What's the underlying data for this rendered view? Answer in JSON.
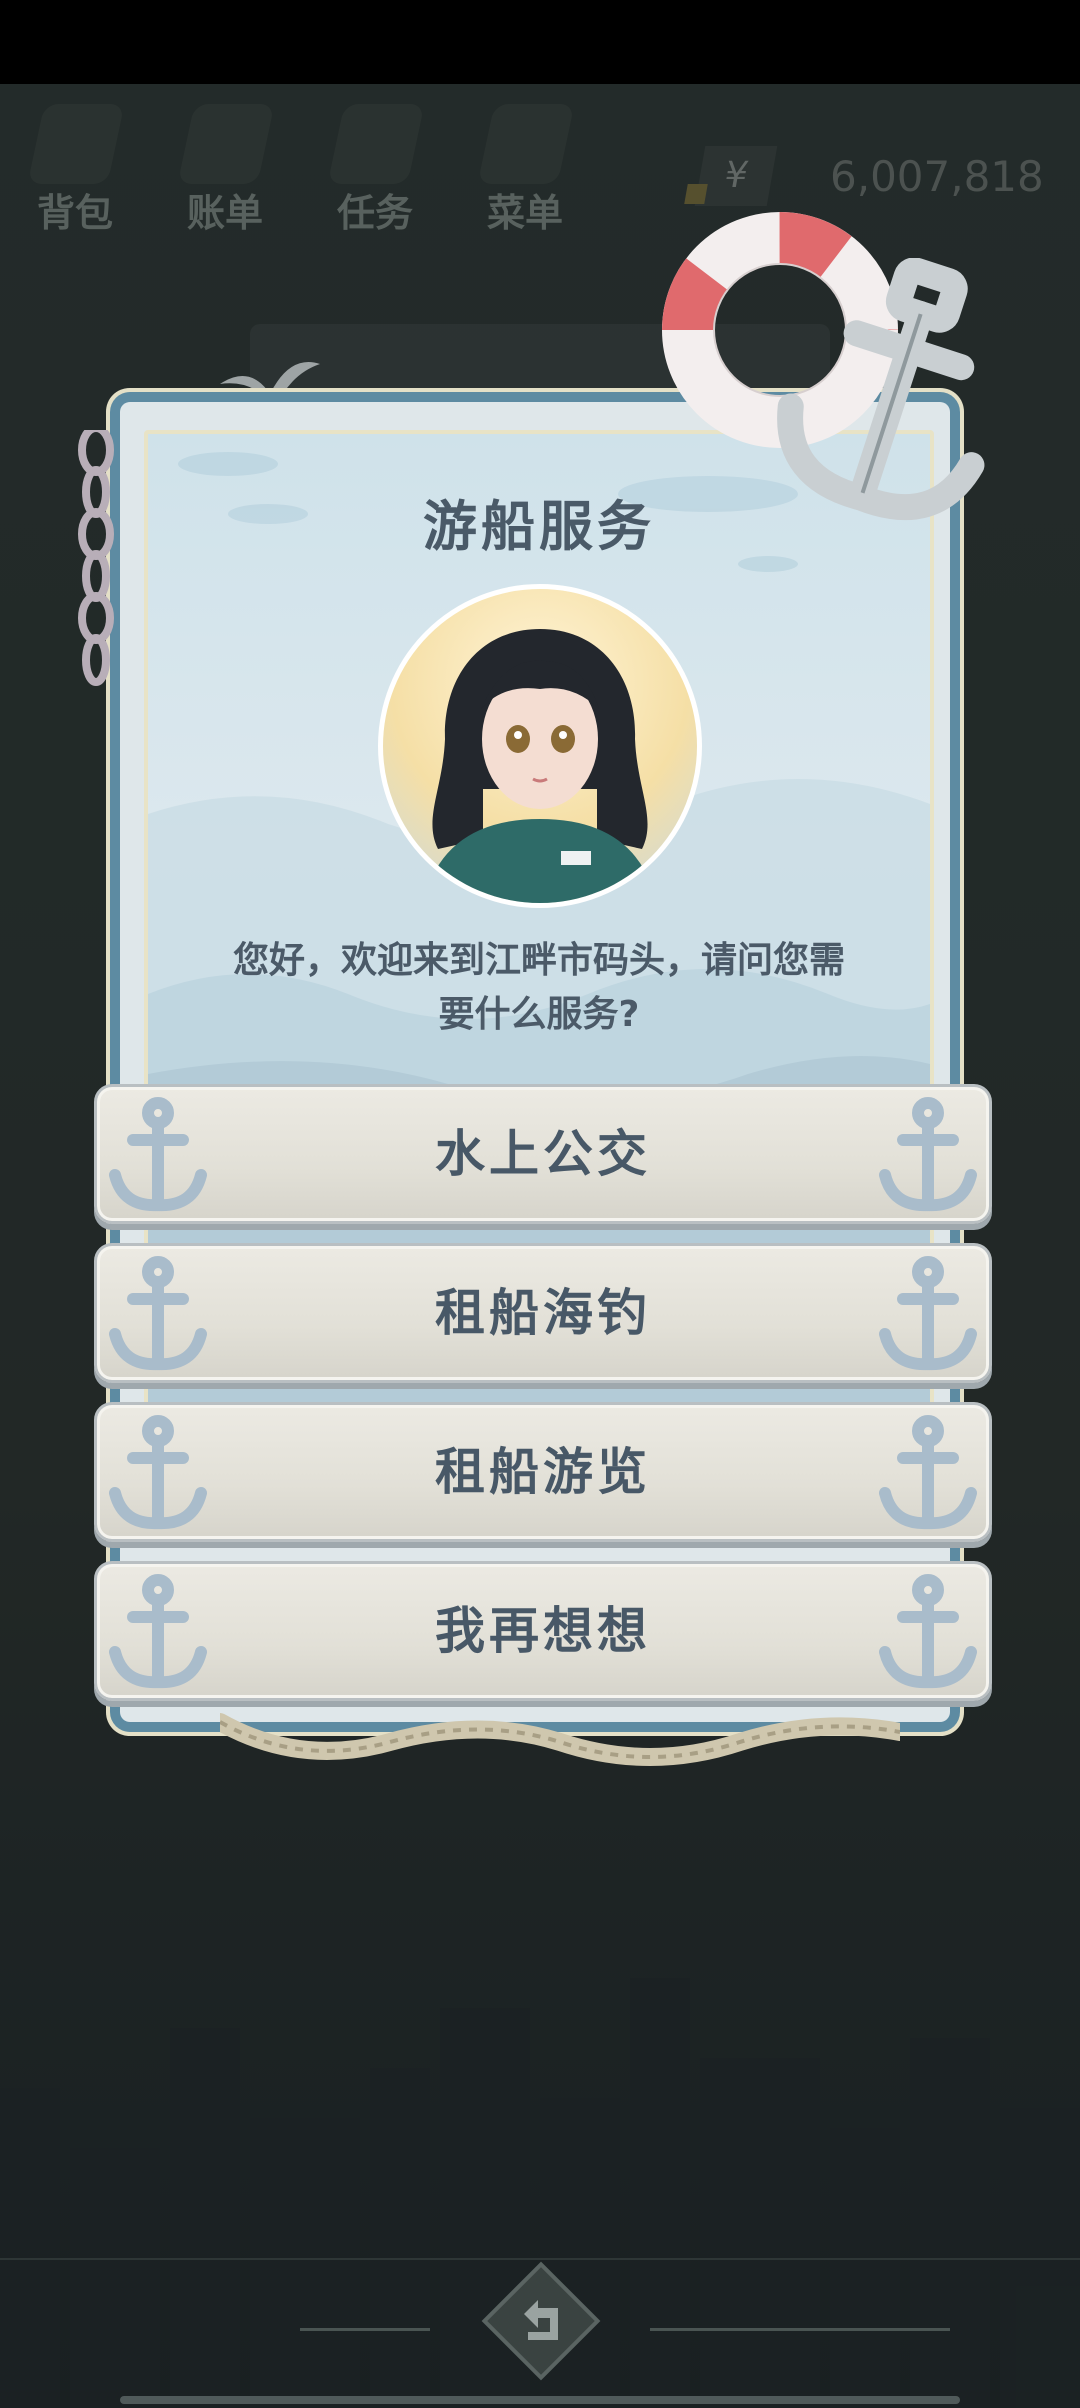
{
  "hud": {
    "items": [
      {
        "label": "背包",
        "icon": "bag-icon"
      },
      {
        "label": "账单",
        "icon": "bill-icon"
      },
      {
        "label": "任务",
        "icon": "task-icon"
      },
      {
        "label": "菜单",
        "icon": "menu-icon"
      }
    ],
    "currency_symbol": "¥",
    "money": "6,007,818"
  },
  "dialog": {
    "title": "游船服务",
    "message": "您好，欢迎来到江畔市码头，请问您需要什么服务?",
    "options": [
      {
        "label": "水上公交"
      },
      {
        "label": "租船海钓"
      },
      {
        "label": "租船游览"
      },
      {
        "label": "我再想想"
      }
    ]
  },
  "colors": {
    "panel_border": "#5d8ba2",
    "button_text": "#485867",
    "anchor": "#a9bccb",
    "buoy_red": "#e06a6d"
  },
  "nav": {
    "back_icon": "back-arrow-icon"
  }
}
